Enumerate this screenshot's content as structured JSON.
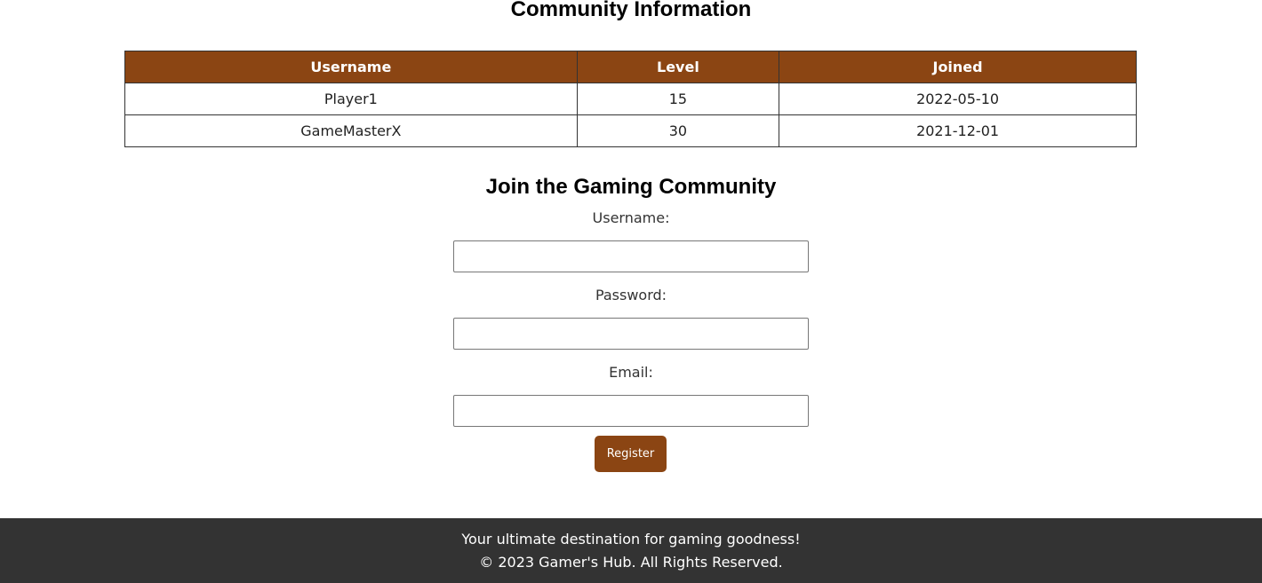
{
  "community": {
    "title": "Community Information",
    "columns": [
      "Username",
      "Level",
      "Joined"
    ],
    "rows": [
      [
        "Player1",
        "15",
        "2022-05-10"
      ],
      [
        "GameMasterX",
        "30",
        "2021-12-01"
      ]
    ]
  },
  "join": {
    "title": "Join the Gaming Community",
    "username_label": "Username:",
    "username_value": "",
    "password_label": "Password:",
    "password_value": "",
    "email_label": "Email:",
    "email_value": "",
    "register_label": "Register"
  },
  "footer": {
    "tagline": "Your ultimate destination for gaming goodness!",
    "copyright": "© 2023 Gamer's Hub. All Rights Reserved."
  },
  "colors": {
    "accent": "#8B4513",
    "footer_bg": "#333333"
  }
}
